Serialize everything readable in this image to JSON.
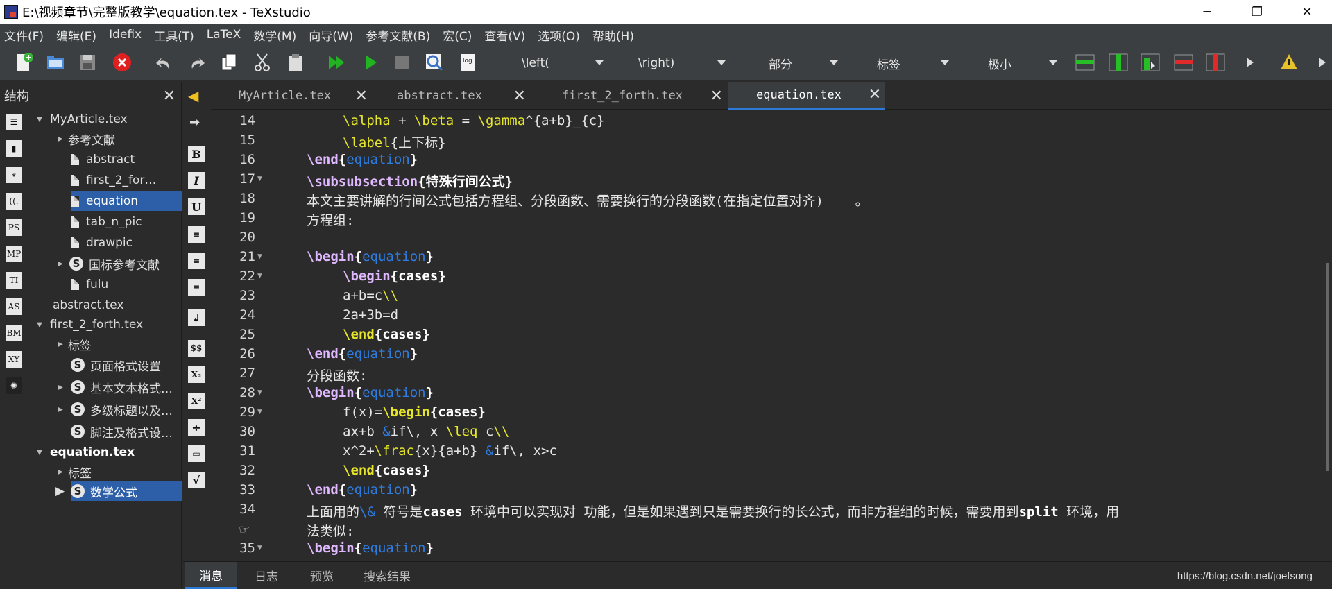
{
  "window": {
    "title": "E:\\视频章节\\完整版教学\\equation.tex - TeXstudio",
    "minimize": "─",
    "maximize": "❐",
    "close": "✕"
  },
  "menu": [
    "文件(F)",
    "编辑(E)",
    "Idefix",
    "工具(T)",
    "LaTeX",
    "数学(M)",
    "向导(W)",
    "参考文献(B)",
    "宏(C)",
    "查看(V)",
    "选项(O)",
    "帮助(H)"
  ],
  "toolbar": {
    "left_combo": "\\left(",
    "right_combo": "\\right)",
    "section_combo": "部分",
    "label_combo": "标签",
    "size_combo": "极小"
  },
  "structure": {
    "title": "结构",
    "close": "✕",
    "items": [
      {
        "label": "MyArticle.tex",
        "arrow": "▼"
      },
      {
        "label": "参考文献",
        "arrow": "▶"
      },
      {
        "label": "abstract"
      },
      {
        "label": "first_2_for…"
      },
      {
        "label": "equation"
      },
      {
        "label": "tab_n_pic"
      },
      {
        "label": "drawpic"
      },
      {
        "label": "国标参考文献",
        "arrow": "▶",
        "badge": "S"
      },
      {
        "label": "fulu"
      },
      {
        "label": "abstract.tex"
      },
      {
        "label": "first_2_forth.tex",
        "arrow": "▼"
      },
      {
        "label": "标签",
        "arrow": "▶"
      },
      {
        "label": "页面格式设置",
        "badge": "S"
      },
      {
        "label": "基本文本格式…",
        "arrow": "▶",
        "badge": "S"
      },
      {
        "label": "多级标题以及…",
        "arrow": "▶",
        "badge": "S"
      },
      {
        "label": "脚注及格式设…",
        "badge": "S"
      },
      {
        "label": "equation.tex",
        "arrow": "▼"
      },
      {
        "label": "标签",
        "arrow": "▶"
      },
      {
        "label": "数学公式",
        "arrow": "▶",
        "badge": "S"
      }
    ]
  },
  "side_icons": {
    "bold": "B",
    "italic": "I",
    "underline": "U",
    "dollar": "$$"
  },
  "tabs": [
    {
      "label": "MyArticle.tex"
    },
    {
      "label": "abstract.tex"
    },
    {
      "label": "first_2_forth.tex"
    },
    {
      "label": "equation.tex"
    }
  ],
  "tab_close": "✕",
  "editor": {
    "line_numbers": [
      "14",
      "15",
      "16",
      "17",
      "18",
      "19",
      "20",
      "21",
      "22",
      "23",
      "24",
      "25",
      "26",
      "27",
      "28",
      "29",
      "30",
      "31",
      "32",
      "33",
      "34",
      "35"
    ],
    "l14_a": "\\alpha",
    "l14_b": " + ",
    "l14_c": "\\beta",
    "l14_d": " = ",
    "l14_e": "\\gamma",
    "l14_f": "^{a+b}_{c}",
    "l15_a": "\\label",
    "l15_b": "{上下标}",
    "end": "\\end",
    "begin": "\\begin",
    "equation": "equation",
    "lbrace": "{",
    "rbrace": "}",
    "l17_a": "\\subsubsection",
    "l17_b": "{特殊行间公式}",
    "l18": "本文主要讲解的行间公式包括方程组、分段函数、需要换行的分段函数(在指定位置对齐)    。",
    "l19": "方程组:",
    "cases": "{cases}",
    "l23_a": "a+b=c",
    "dbs": "\\\\",
    "l24": "2a+3b=d",
    "l27": "分段函数:",
    "l29_a": "f(x)=",
    "l30_a": "ax+b ",
    "amp": "&",
    "l30_b": "if\\, x ",
    "l30_c": "\\leq",
    "l30_d": " c",
    "l31_a": "x^2+",
    "l31_b": "\\frac",
    "l31_c": "{x}{a+b} ",
    "l31_d": "if\\, x>c",
    "l34_a": "上面用的",
    "l34_b": "\\&",
    "l34_c": " 符号是",
    "l34_d": "cases",
    "l34_e": " 环境中可以实现对 功能，但是如果遇到只是需要换行的长公式，而非方程组的时候，需要用到",
    "l34_f": "split",
    "l34_g": " 环境，用",
    "l34_h": "法类似:"
  },
  "bottom_tabs": [
    "消息",
    "日志",
    "预览",
    "搜索结果"
  ],
  "watermark": "https://blog.csdn.net/joefsong"
}
